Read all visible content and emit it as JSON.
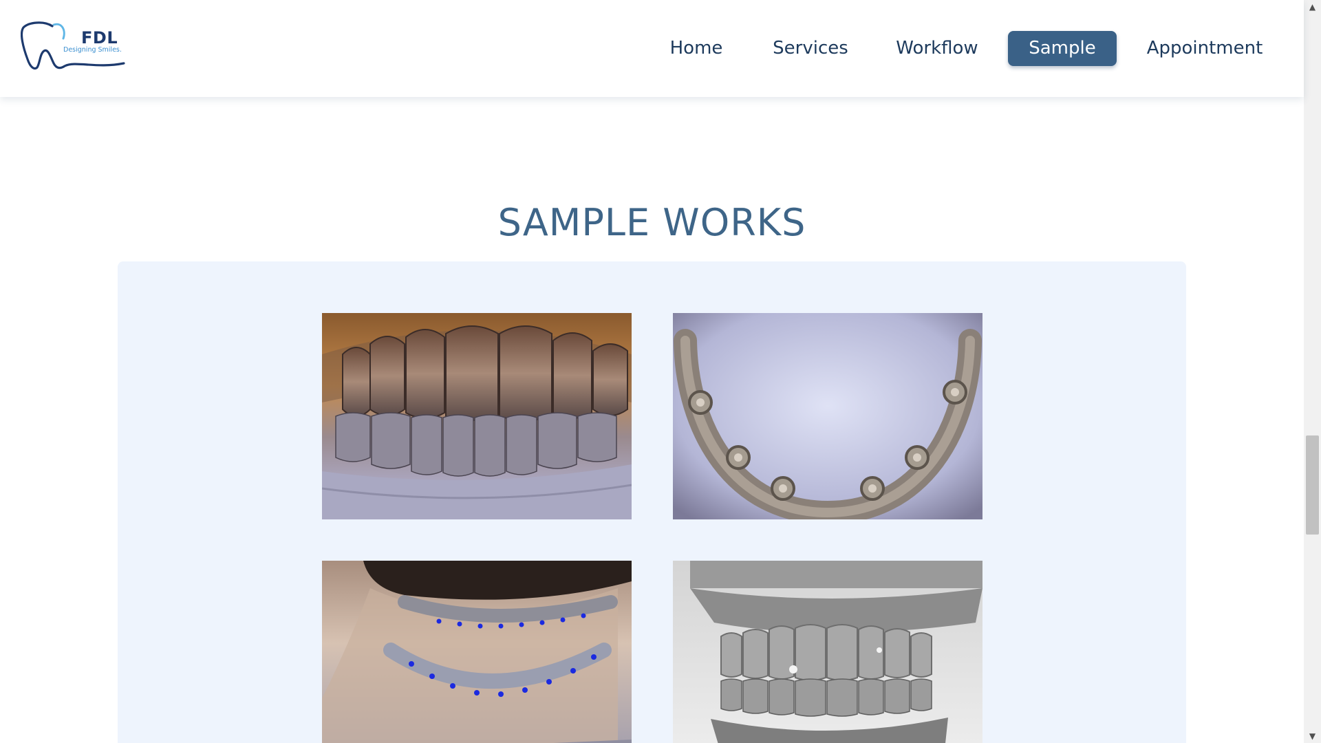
{
  "logo": {
    "title": "FDL",
    "tagline": "Designing Smiles."
  },
  "nav": {
    "items": [
      {
        "label": "Home",
        "active": false
      },
      {
        "label": "Services",
        "active": false
      },
      {
        "label": "Workflow",
        "active": false
      },
      {
        "label": "Sample",
        "active": true
      },
      {
        "label": "Appointment",
        "active": false
      }
    ]
  },
  "section": {
    "title": "SAMPLE WORKS"
  },
  "gallery": {
    "items": [
      {
        "subject": "full-arch-crowns-render"
      },
      {
        "subject": "implant-bar-guide-render"
      },
      {
        "subject": "guide-on-model-render"
      },
      {
        "subject": "articulated-model-scan"
      }
    ]
  },
  "colors": {
    "brand": "#3a6187",
    "title": "#3e6588",
    "gallery_bg": "#eef4fd",
    "nav_text": "#1d3a5c"
  }
}
